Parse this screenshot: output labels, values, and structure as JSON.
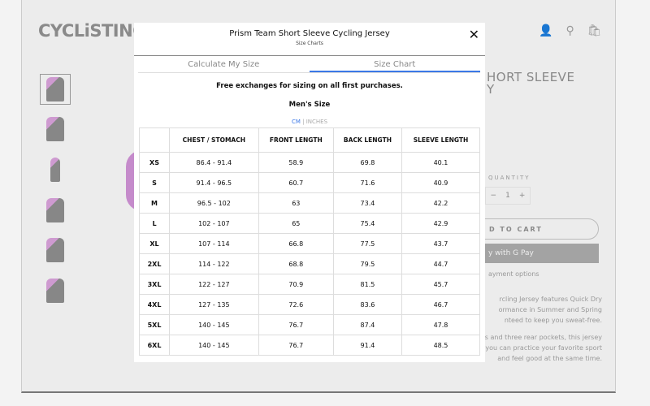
{
  "site": {
    "logo": "CYCLiSTING",
    "product_title_line1": "HORT SLEEVE",
    "product_title_line2": "Y",
    "quantity_label": "QUANTITY",
    "quantity_value": "1",
    "qty_minus": "−",
    "qty_plus": "+",
    "add_to_cart": "D TO CART",
    "gpay": "y with G Pay",
    "more_payment": "ayment options",
    "desc1": "rcling Jersey features Quick Dry",
    "desc2": "ormance in Summer and Spring",
    "desc3": "nteed to keep you sweat-free.",
    "desc4": "cs and three rear pockets, this jersey",
    "desc5": "you can practice your favorite sport",
    "desc6": "and feel good at the same time."
  },
  "modal": {
    "title": "Prism Team Short Sleeve Cycling Jersey",
    "subtitle": "Size Charts",
    "close": "✕",
    "tabs": [
      {
        "label": "Calculate My Size",
        "active": false
      },
      {
        "label": "Size Chart",
        "active": true
      }
    ],
    "note": "Free exchanges for sizing on all first purchases.",
    "size_label": "Men's Size",
    "unit_cm": "CM",
    "unit_sep": "|",
    "unit_in": "INCHES",
    "columns": [
      "",
      "CHEST / STOMACH",
      "FRONT LENGTH",
      "BACK LENGTH",
      "SLEEVE LENGTH"
    ],
    "rows": [
      [
        "XS",
        "86.4 - 91.4",
        "58.9",
        "69.8",
        "40.1"
      ],
      [
        "S",
        "91.4 - 96.5",
        "60.7",
        "71.6",
        "40.9"
      ],
      [
        "M",
        "96.5 - 102",
        "63",
        "73.4",
        "42.2"
      ],
      [
        "L",
        "102 - 107",
        "65",
        "75.4",
        "42.9"
      ],
      [
        "XL",
        "107 - 114",
        "66.8",
        "77.5",
        "43.7"
      ],
      [
        "2XL",
        "114 - 122",
        "68.8",
        "79.5",
        "44.7"
      ],
      [
        "3XL",
        "122 - 127",
        "70.9",
        "81.5",
        "45.7"
      ],
      [
        "4XL",
        "127 - 135",
        "72.6",
        "83.6",
        "46.7"
      ],
      [
        "5XL",
        "140 - 145",
        "76.7",
        "87.4",
        "47.8"
      ],
      [
        "6XL",
        "140 - 145",
        "76.7",
        "91.4",
        "48.5"
      ]
    ]
  },
  "colors": {
    "accent": "#3b78e7"
  }
}
